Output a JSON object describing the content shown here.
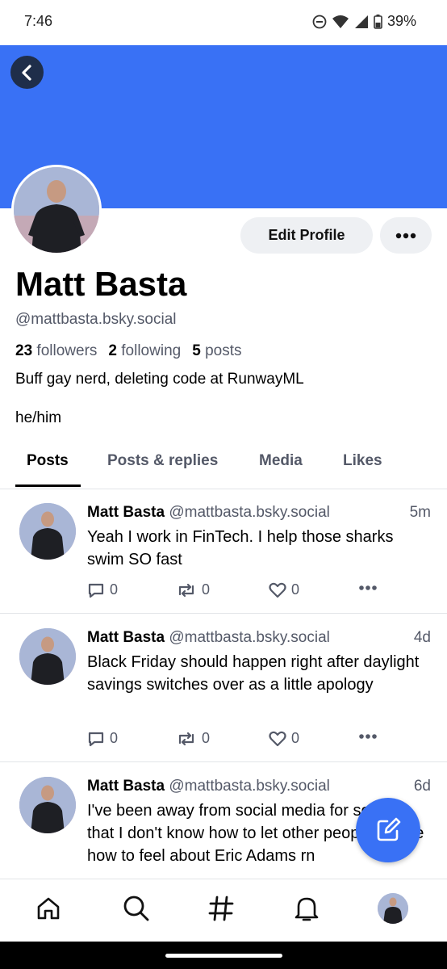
{
  "status_bar": {
    "time": "7:46",
    "battery": "39%"
  },
  "colors": {
    "banner": "#3971f5",
    "accent": "#3971f5",
    "muted_text": "#545968"
  },
  "profile": {
    "display_name": "Matt Basta",
    "handle": "@mattbasta.bsky.social",
    "edit_label": "Edit Profile",
    "followers_count": "23",
    "followers_label": "followers",
    "following_count": "2",
    "following_label": "following",
    "posts_count": "5",
    "posts_label": "posts",
    "bio_line1": "Buff gay nerd, deleting code at RunwayML",
    "bio_line2": "he/him"
  },
  "tabs": [
    {
      "label": "Posts",
      "active": true
    },
    {
      "label": "Posts & replies",
      "active": false
    },
    {
      "label": "Media",
      "active": false
    },
    {
      "label": "Likes",
      "active": false
    }
  ],
  "posts": [
    {
      "author": "Matt Basta",
      "handle": "@mattbasta.bsky.social",
      "time": "5m",
      "text": "Yeah I work in FinTech. I help those sharks swim SO fast",
      "replies": "0",
      "reposts": "0",
      "likes": "0"
    },
    {
      "author": "Matt Basta",
      "handle": "@mattbasta.bsky.social",
      "time": "4d",
      "text": "Black Friday should happen right after daylight savings switches over as a little apology",
      "replies": "0",
      "reposts": "0",
      "likes": "0"
    },
    {
      "author": "Matt Basta",
      "handle": "@mattbasta.bsky.social",
      "time": "6d",
      "text": "I've been away from social media for so long that I don't know how to let other people tell me how to feel about Eric Adams rn"
    }
  ],
  "icons": {
    "back": "chevron-left-icon",
    "more": "ellipsis-icon",
    "compose": "compose-icon",
    "nav": [
      "home-icon",
      "search-icon",
      "hashtag-icon",
      "bell-icon",
      "avatar"
    ]
  }
}
